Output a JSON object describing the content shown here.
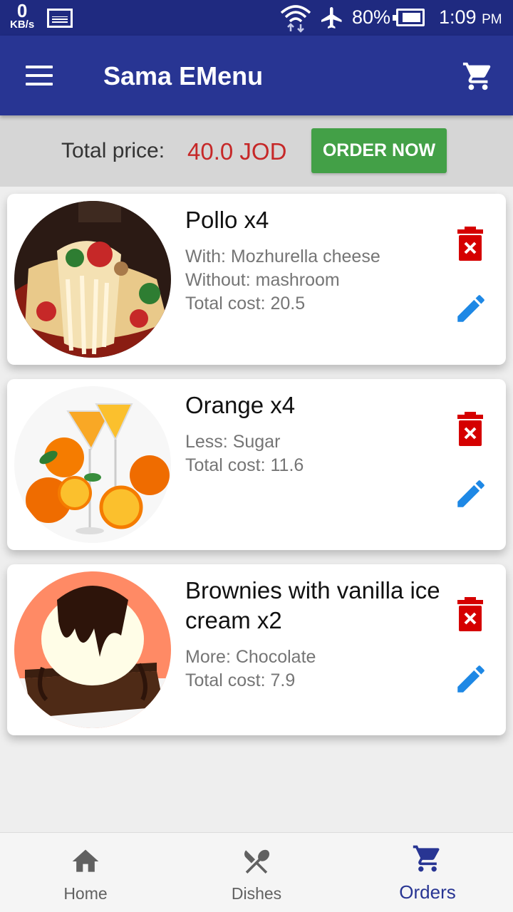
{
  "status_bar": {
    "net_speed": "0",
    "net_unit": "KB/s",
    "battery": "80%",
    "time": "1:09",
    "ampm": "PM"
  },
  "app_bar": {
    "title": "Sama EMenu",
    "menu_icon": "hamburger-menu-icon",
    "cart_icon": "shopping-cart-icon"
  },
  "summary": {
    "total_label": "Total price:",
    "total_value": "40.0 JOD",
    "order_button": "ORDER NOW"
  },
  "orders": [
    {
      "name": "Pollo x4",
      "details": [
        "With: Mozhurella cheese",
        "Without: mashroom",
        "Total cost: 20.5"
      ]
    },
    {
      "name": "Orange x4",
      "details": [
        "Less: Sugar",
        "Total cost: 11.6"
      ]
    },
    {
      "name": "Brownies with vanilla ice cream x2",
      "details": [
        "More: Chocolate",
        "Total cost: 7.9"
      ]
    }
  ],
  "bottom_nav": {
    "items": [
      {
        "label": "Home",
        "icon": "home-icon"
      },
      {
        "label": "Dishes",
        "icon": "fork-spoon-icon"
      },
      {
        "label": "Orders",
        "icon": "shopping-cart-icon"
      }
    ],
    "active": "Orders"
  },
  "colors": {
    "primary": "#283593",
    "status_bar": "#1f2a80",
    "total_value": "#c62828",
    "order_button": "#43a047",
    "delete_icon": "#d50000",
    "edit_icon": "#1e88e5"
  }
}
